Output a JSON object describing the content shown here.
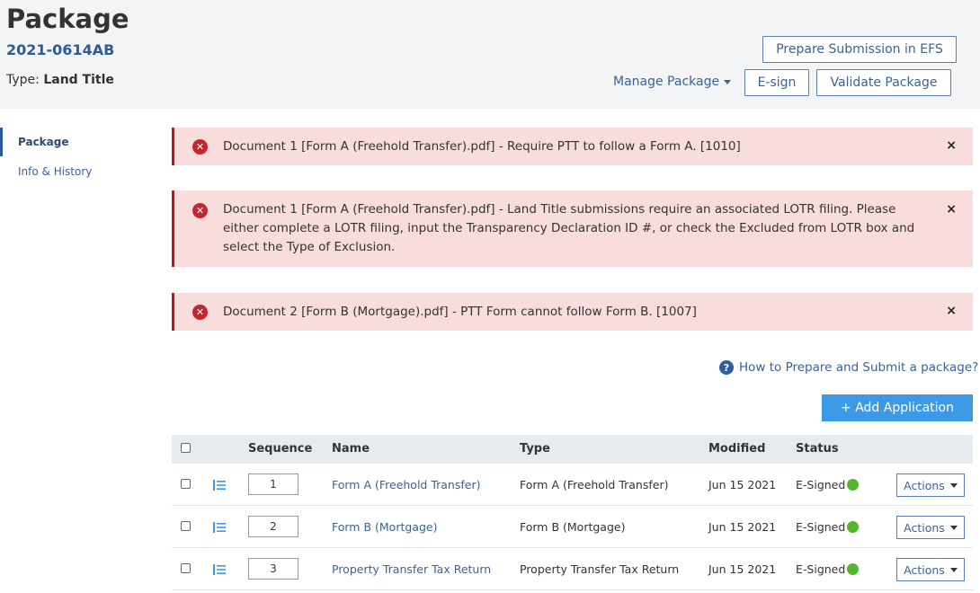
{
  "header": {
    "title": "Package",
    "package_id": "2021-0614AB",
    "type_label": "Type:",
    "type_value": "Land Title",
    "prepare_efs": "Prepare Submission in EFS",
    "manage_package": "Manage Package",
    "esign": "E-sign",
    "validate": "Validate Package"
  },
  "sidebar": {
    "items": [
      {
        "label": "Package"
      },
      {
        "label": "Info & History"
      }
    ]
  },
  "alerts": [
    {
      "text": "Document 1 [Form A (Freehold Transfer).pdf] - Require PTT to follow a Form A. [1010]"
    },
    {
      "text": "Document 1 [Form A (Freehold Transfer).pdf] - Land Title submissions require an associated LOTR filing. Please either complete a LOTR filing, input the Transparency Declaration ID #, or check the Excluded from LOTR box and select the Type of Exclusion."
    },
    {
      "text": "Document 2 [Form B (Mortgage).pdf] - PTT Form cannot follow Form B. [1007]"
    }
  ],
  "alert_close": "×",
  "help": {
    "icon_text": "?",
    "text": "How to Prepare and Submit a package?"
  },
  "add_application": "+ Add Application",
  "table": {
    "headers": {
      "sequence": "Sequence",
      "name": "Name",
      "type": "Type",
      "modified": "Modified",
      "status": "Status"
    },
    "actions_label": "Actions",
    "rows": [
      {
        "sequence": "1",
        "name": "Form A (Freehold Transfer)",
        "type": "Form A (Freehold Transfer)",
        "modified": "Jun 15 2021",
        "status": "E-Signed"
      },
      {
        "sequence": "2",
        "name": "Form B (Mortgage)",
        "type": "Form B (Mortgage)",
        "modified": "Jun 15 2021",
        "status": "E-Signed"
      },
      {
        "sequence": "3",
        "name": "Property Transfer Tax Return",
        "type": "Property Transfer Tax Return",
        "modified": "Jun 15 2021",
        "status": "E-Signed"
      }
    ]
  },
  "colors": {
    "brand_blue": "#2d5b9a",
    "alert_bg": "#f9dcdc",
    "alert_border": "#c0171e",
    "primary_button": "#3b99e6",
    "status_green": "#55b52e"
  }
}
